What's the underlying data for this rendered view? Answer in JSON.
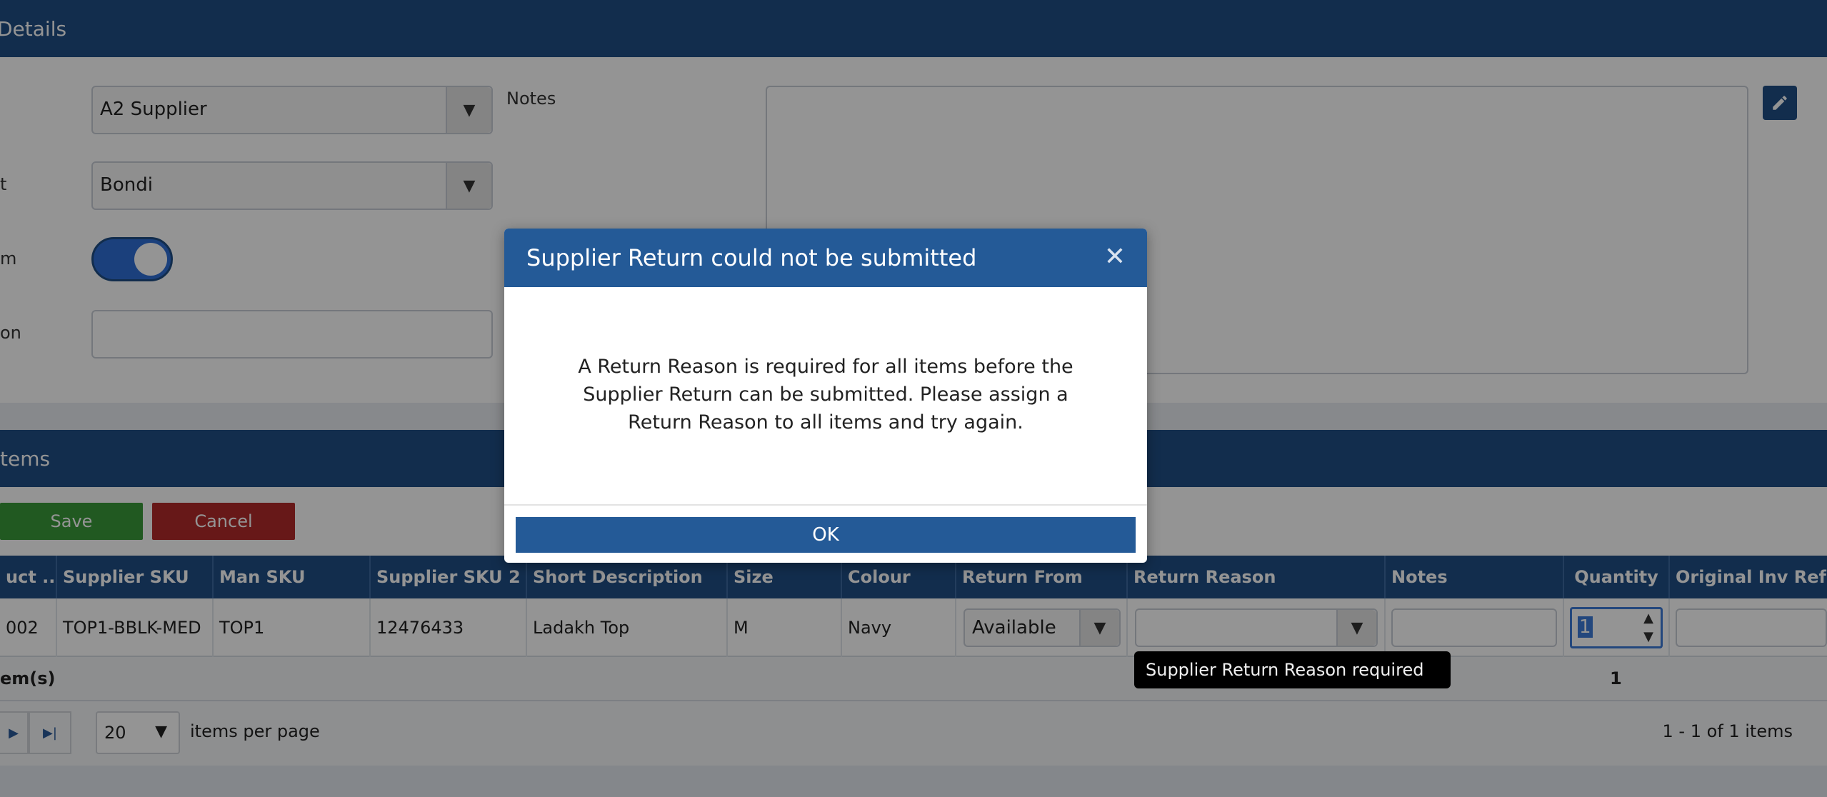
{
  "details": {
    "header_title": "Details",
    "supplier_value": "A2 Supplier",
    "location_label": "t",
    "location_value": "Bondi",
    "toggle_label": "m",
    "reference_label": "on",
    "notes_label": "Notes"
  },
  "items": {
    "header_title": "tems",
    "save_label": "Save",
    "cancel_label": "Cancel",
    "columns": [
      "uct ...",
      "Supplier SKU",
      "Man SKU",
      "Supplier SKU 2",
      "Short Description",
      "Size",
      "Colour",
      "Return From",
      "Return Reason",
      "Notes",
      "Quantity",
      "Original Inv Ref"
    ],
    "row": {
      "product": "002",
      "supplier_sku": "TOP1-BBLK-MED",
      "man_sku": "TOP1",
      "supplier_sku_2": "12476433",
      "short_description": "Ladakh Top",
      "size": "M",
      "colour": "Navy",
      "return_from": "Available",
      "return_reason": "",
      "notes": "",
      "quantity": "1"
    },
    "total_label": "em(s)",
    "total_quantity": "1",
    "tooltip": "Supplier Return Reason required"
  },
  "pager": {
    "page_size": "20",
    "per_page_label": "items per page",
    "summary": "1 - 1 of 1 items"
  },
  "modal": {
    "title": "Supplier Return could not be submitted",
    "message": "A Return Reason is required for all items before the Supplier Return can be submitted. Please assign a Return Reason to all items and try again.",
    "ok_label": "OK",
    "close_glyph": "✕"
  },
  "icons": {
    "dropdown": "caret-down-icon",
    "edit": "pencil-icon",
    "next": "next-page-icon",
    "last": "last-page-icon",
    "spin": "spinner-arrows-icon"
  },
  "colors": {
    "primary": "#1f4e86",
    "save": "#3a9a3a",
    "cancel": "#b22a2a",
    "toggle_on": "#2f6fd6"
  }
}
